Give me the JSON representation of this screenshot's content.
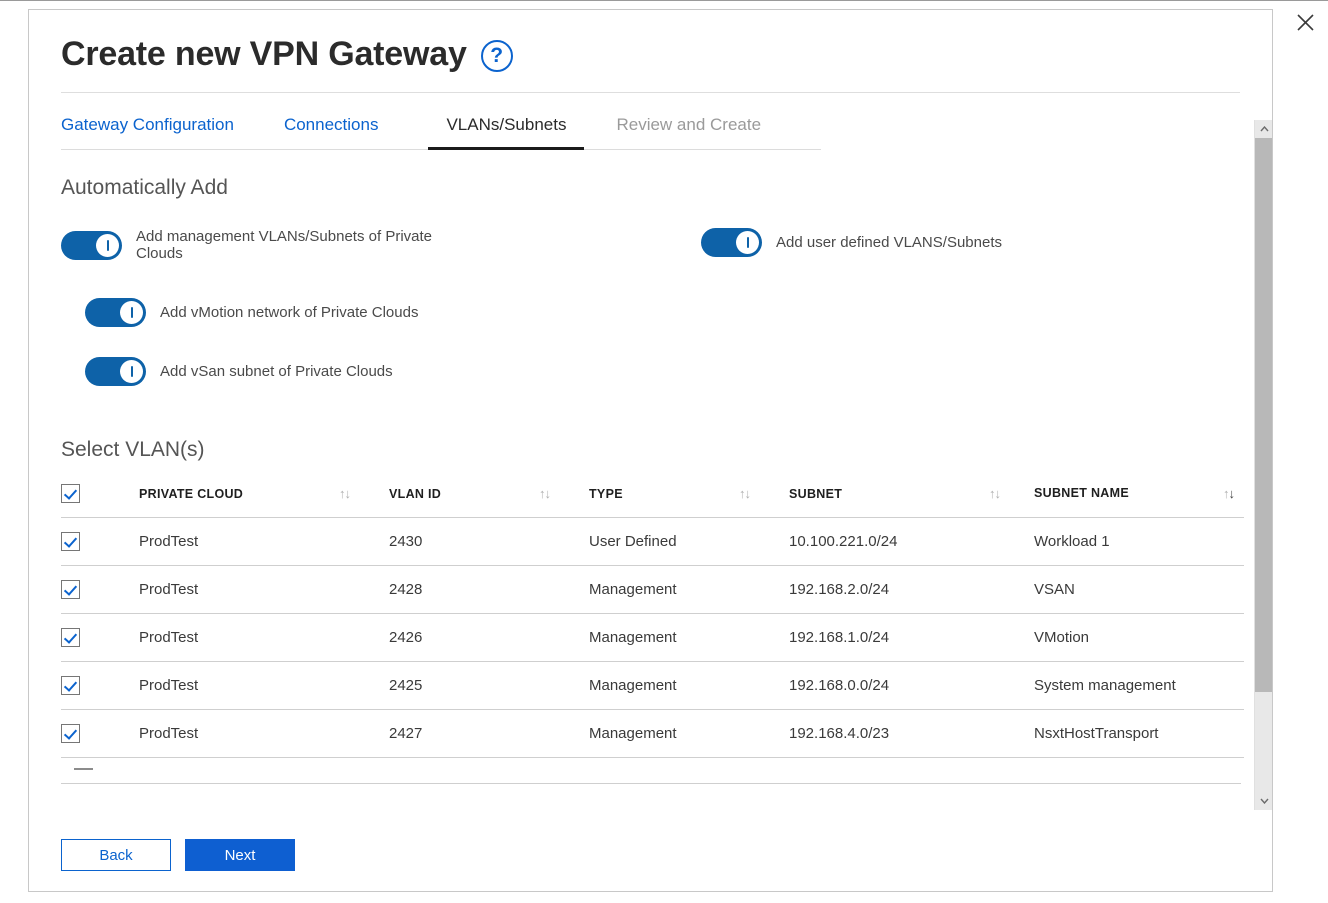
{
  "window": {
    "close_label": "×",
    "close_icon": "close-icon"
  },
  "header": {
    "title": "Create new VPN Gateway",
    "help_icon_label": "?"
  },
  "tabs": [
    {
      "label": "Gateway Configuration",
      "state": "link"
    },
    {
      "label": "Connections",
      "state": "link"
    },
    {
      "label": "VLANs/Subnets",
      "state": "active"
    },
    {
      "label": "Review and Create",
      "state": "disabled"
    }
  ],
  "sections": {
    "automatically_add": "Automatically Add",
    "select_vlans": "Select VLAN(s)"
  },
  "toggles": [
    {
      "label": "Add management VLANs/Subnets of Private Clouds",
      "on": true
    },
    {
      "label": "Add user defined VLANS/Subnets",
      "on": true
    },
    {
      "label": "Add vMotion network of Private Clouds",
      "on": true
    },
    {
      "label": "Add vSan subnet of Private Clouds",
      "on": true
    }
  ],
  "table": {
    "select_all_checked": true,
    "columns": [
      {
        "label": "PRIVATE CLOUD",
        "sortable": true,
        "sort_state": "none"
      },
      {
        "label": "VLAN ID",
        "sortable": true,
        "sort_state": "none"
      },
      {
        "label": "TYPE",
        "sortable": true,
        "sort_state": "none"
      },
      {
        "label": "SUBNET",
        "sortable": true,
        "sort_state": "none"
      },
      {
        "label": "SUBNET NAME",
        "sortable": true,
        "sort_state": "desc"
      }
    ],
    "rows": [
      {
        "checked": true,
        "private_cloud": "ProdTest",
        "vlan_id": "2430",
        "type": "User Defined",
        "subnet": "10.100.221.0/24",
        "subnet_name": "Workload 1"
      },
      {
        "checked": true,
        "private_cloud": "ProdTest",
        "vlan_id": "2428",
        "type": "Management",
        "subnet": "192.168.2.0/24",
        "subnet_name": "VSAN"
      },
      {
        "checked": true,
        "private_cloud": "ProdTest",
        "vlan_id": "2426",
        "type": "Management",
        "subnet": "192.168.1.0/24",
        "subnet_name": "VMotion"
      },
      {
        "checked": true,
        "private_cloud": "ProdTest",
        "vlan_id": "2425",
        "type": "Management",
        "subnet": "192.168.0.0/24",
        "subnet_name": "System management"
      },
      {
        "checked": true,
        "private_cloud": "ProdTest",
        "vlan_id": "2427",
        "type": "Management",
        "subnet": "192.168.4.0/23",
        "subnet_name": "NsxtHostTransport"
      }
    ]
  },
  "footer": {
    "back_label": "Back",
    "next_label": "Next"
  },
  "colors": {
    "accent_blue": "#0b63ce",
    "toggle_blue": "#0e62a8",
    "primary_button": "#0e5fd1",
    "active_tab_underline": "#1b1b1b",
    "disabled_text": "#9a9a9a"
  }
}
